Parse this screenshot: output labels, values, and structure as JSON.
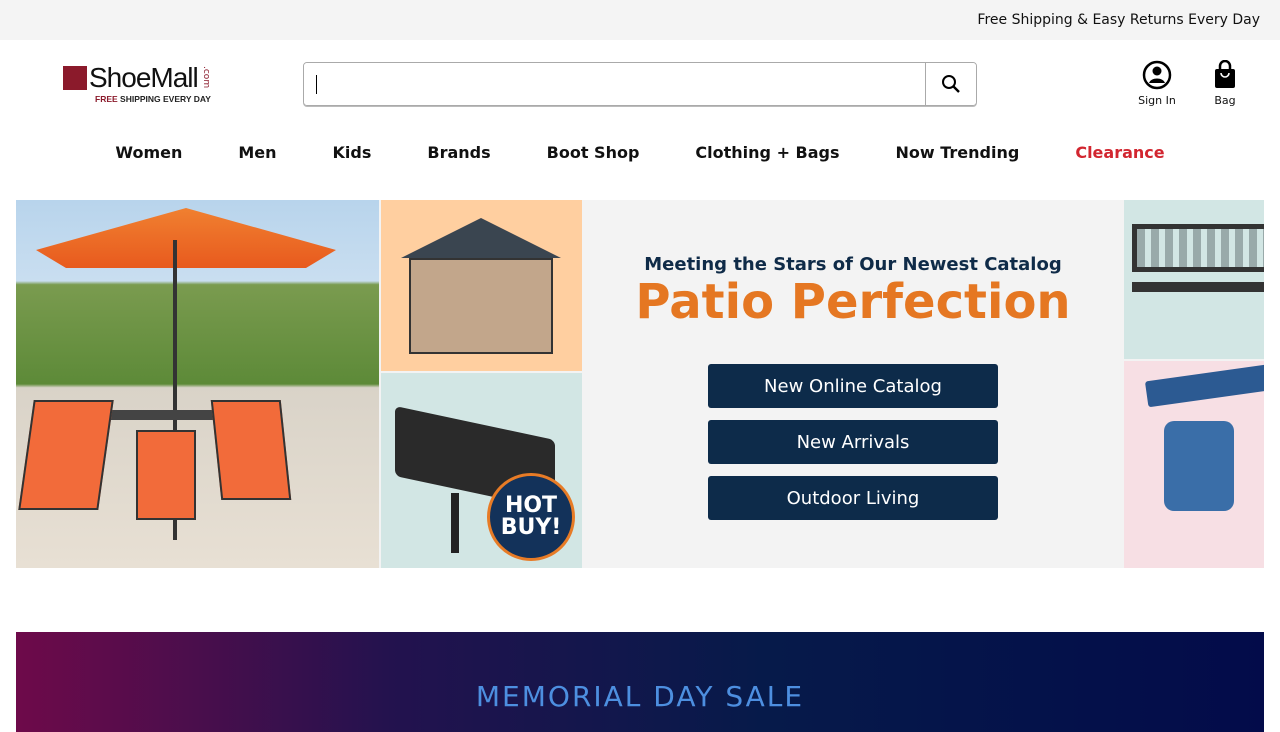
{
  "topbar": {
    "text": "Free Shipping & Easy Returns Every Day"
  },
  "logo": {
    "name": "ShoeMall",
    "com": ".com",
    "tag_free": "FREE",
    "tag_rest": " SHIPPING EVERY DAY"
  },
  "search": {
    "value": "",
    "placeholder": ""
  },
  "account": {
    "signin_label": "Sign In",
    "bag_label": "Bag"
  },
  "nav": {
    "items": [
      "Women",
      "Men",
      "Kids",
      "Brands",
      "Boot Shop",
      "Clothing + Bags",
      "Now Trending",
      "Clearance"
    ]
  },
  "hero": {
    "kicker": "Meeting the Stars of Our Newest Catalog",
    "headline": "Patio Perfection",
    "buttons": [
      "New Online Catalog",
      "New Arrivals",
      "Outdoor Living"
    ],
    "badge_hot": "HOT",
    "badge_buy": "BUY!"
  },
  "promo": {
    "title": "MEMORIAL DAY SALE"
  },
  "colors": {
    "accent": "#e57722",
    "navy": "#0d2b4a",
    "clearance": "#d22630",
    "brand": "#8b1a2b"
  }
}
